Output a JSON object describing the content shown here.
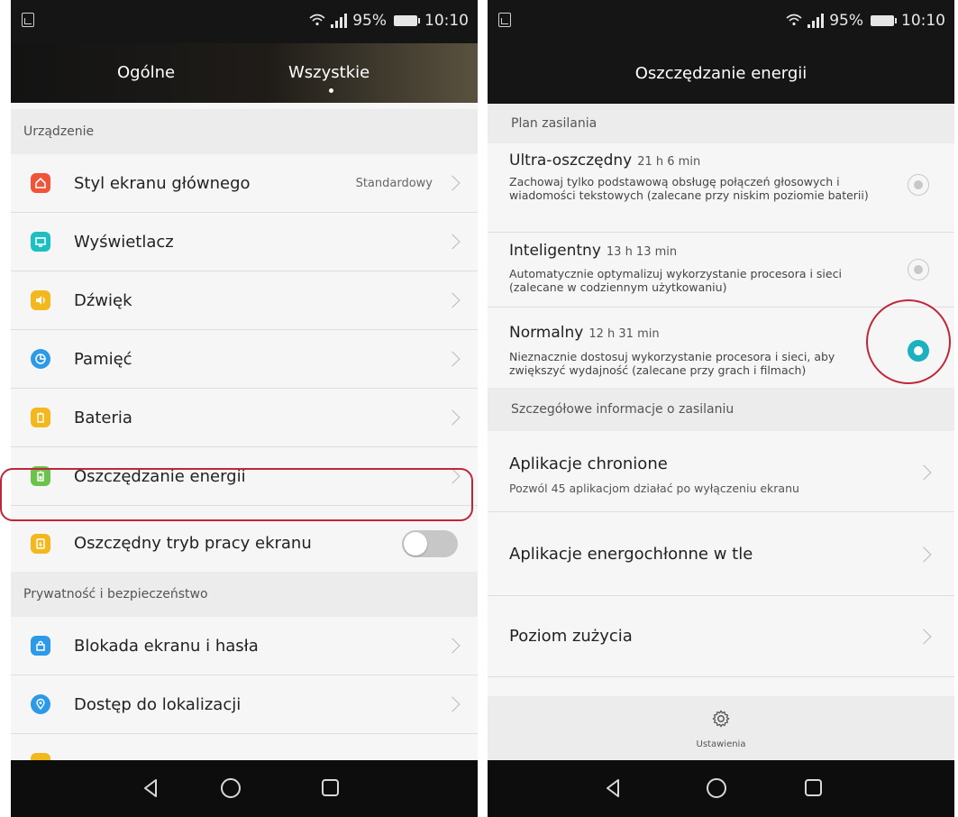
{
  "status": {
    "battery": "95%",
    "time": "10:10"
  },
  "left": {
    "tabs": [
      "Ogólne",
      "Wszystkie"
    ],
    "section1": "Urządzenie",
    "items": [
      {
        "label": "Styl ekranu głównego",
        "value": "Standardowy",
        "color": "#f0553a",
        "icon": "home-icon"
      },
      {
        "label": "Wyświetlacz",
        "value": "",
        "color": "#1ebfc2",
        "icon": "display-icon"
      },
      {
        "label": "Dźwięk",
        "value": "",
        "color": "#f4b81f",
        "icon": "speaker-icon"
      },
      {
        "label": "Pamięć",
        "value": "",
        "color": "#2d9ae8",
        "icon": "pie-chart-icon"
      },
      {
        "label": "Bateria",
        "value": "",
        "color": "#f4b81f",
        "icon": "battery-icon"
      },
      {
        "label": "Oszczędzanie energii",
        "value": "",
        "color": "#6cc24a",
        "icon": "battery-saver-icon"
      },
      {
        "label": "Oszczędny tryb pracy ekranu",
        "value": "",
        "color": "#f4b81f",
        "icon": "screen-saver-icon"
      }
    ],
    "section2": "Prywatność i bezpieczeństwo",
    "items2": [
      {
        "label": "Blokada ekranu i hasła",
        "color": "#2d9ae8",
        "icon": "lock-icon"
      },
      {
        "label": "Dostęp do lokalizacji",
        "color": "#2d9ae8",
        "icon": "location-icon"
      }
    ]
  },
  "right": {
    "title": "Oszczędzanie energii",
    "section1": "Plan zasilania",
    "plans": [
      {
        "name": "Ultra-oszczędny",
        "time": "21 h 6 min",
        "desc": "Zachowaj tylko podstawową obsługę połączeń głosowych i wiadomości tekstowych (zalecane przy niskim poziomie baterii)",
        "selected": false
      },
      {
        "name": "Inteligentny",
        "time": "13 h 13 min",
        "desc": "Automatycznie optymalizuj wykorzystanie procesora i sieci (zalecane w codziennym użytkowaniu)",
        "selected": false
      },
      {
        "name": "Normalny",
        "time": "12 h 31 min",
        "desc": "Nieznacznie dostosuj wykorzystanie procesora i sieci, aby zwiększyć wydajność (zalecane przy grach i filmach)",
        "selected": true
      }
    ],
    "section2": "Szczegółowe informacje o zasilaniu",
    "rows": [
      {
        "title": "Aplikacje chronione",
        "sub": "Pozwól 45 aplikacjom działać po wyłączeniu ekranu"
      },
      {
        "title": "Aplikacje energochłonne w tle",
        "sub": ""
      },
      {
        "title": "Poziom zużycia",
        "sub": ""
      }
    ],
    "footer_label": "Ustawienia"
  }
}
